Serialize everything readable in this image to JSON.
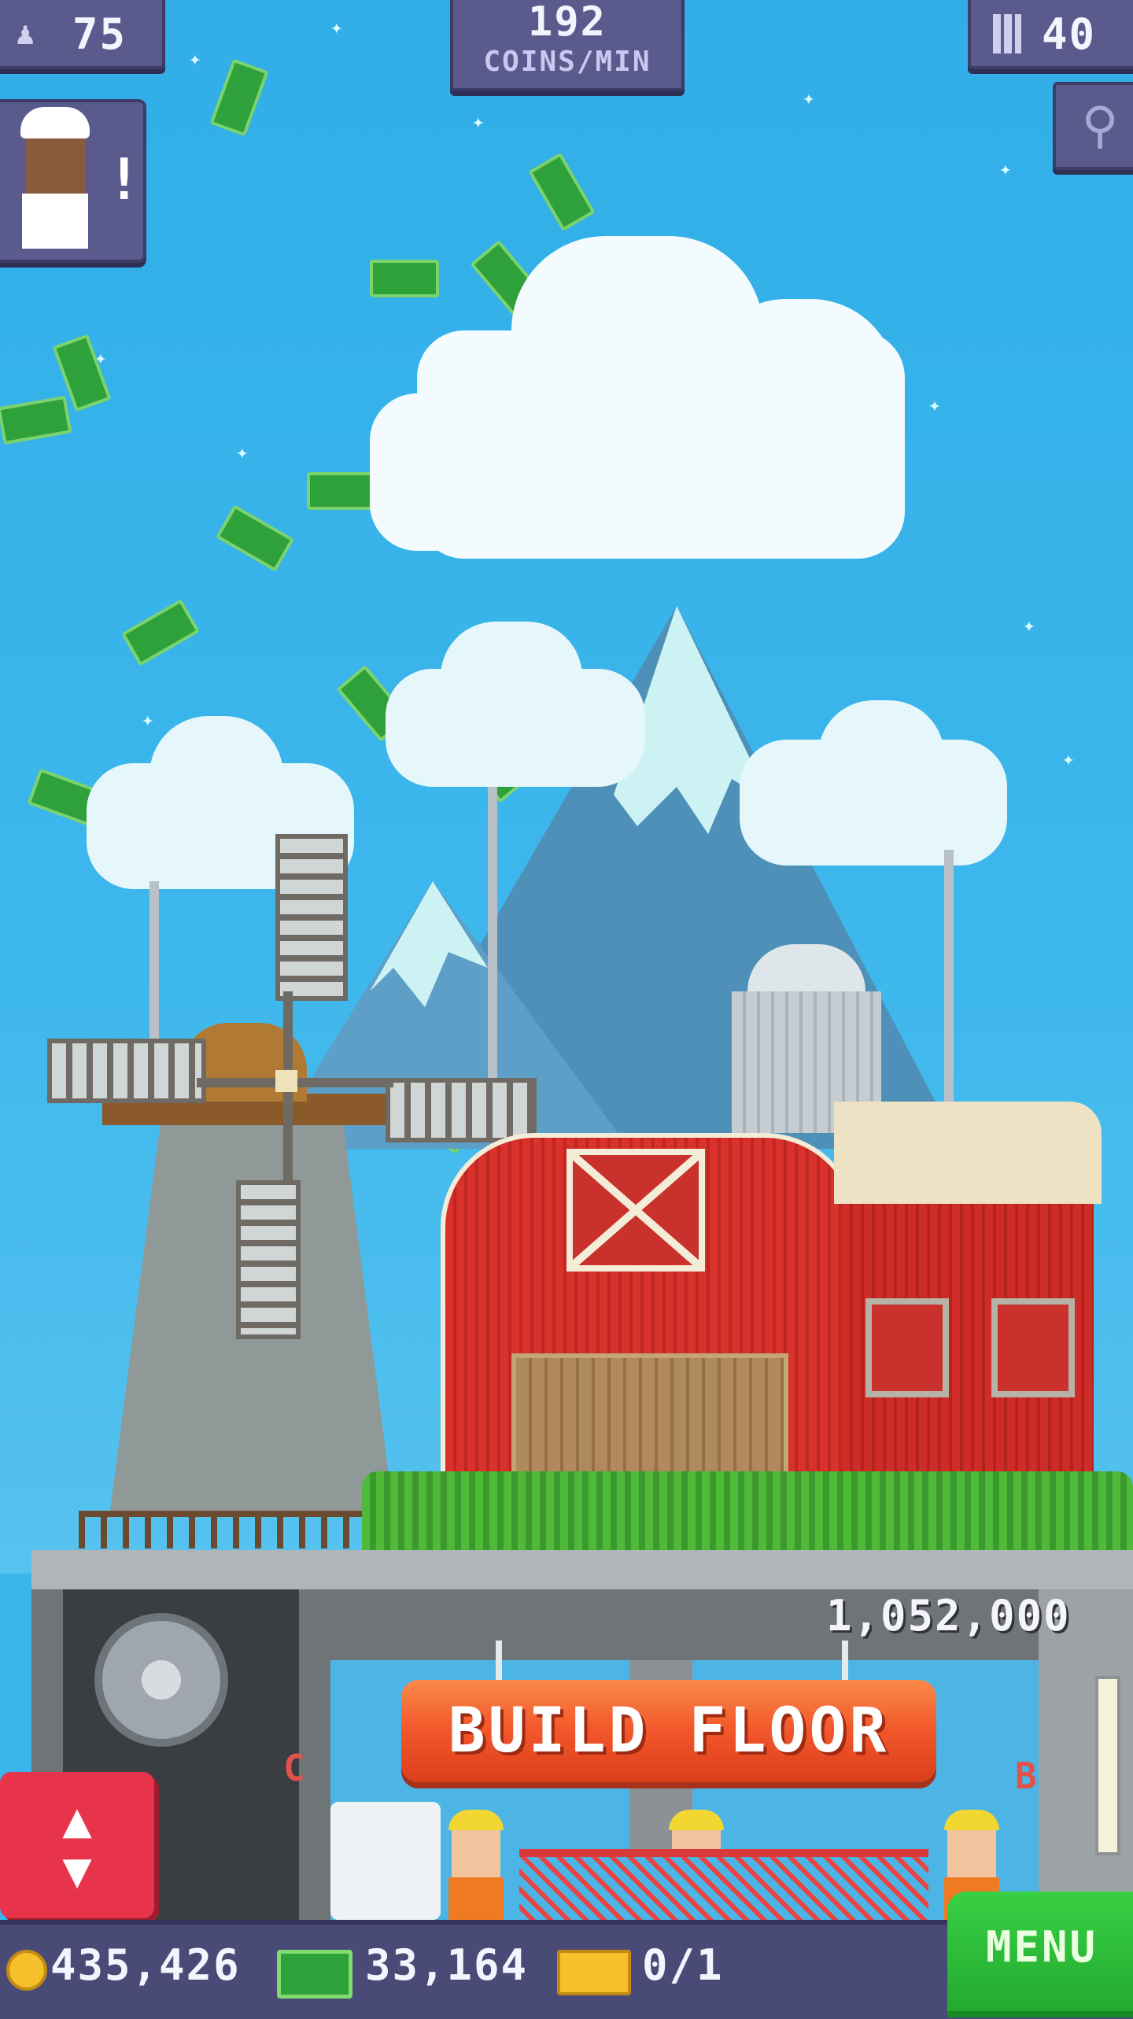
{
  "hud": {
    "population": "75",
    "coins_rate_value": "192",
    "coins_rate_label": "COINS/MIN",
    "floors": "40"
  },
  "build": {
    "label": "BUILD FLOOR",
    "cost": "1,052,000"
  },
  "shop_letters": {
    "left": "C",
    "right": "B"
  },
  "bottom_bar": {
    "coins": "435,426",
    "bux": "33,164",
    "tickets": "0/1",
    "menu_label": "MENU"
  },
  "colors": {
    "sky": "#3ab4ea",
    "hud_panel": "#5a5a8c",
    "build_button": "#f2562a",
    "menu_button": "#2fbd3a",
    "elevator_button": "#e8344a",
    "barn_red": "#d9322c"
  },
  "icons": {
    "population": "person-icon",
    "floors": "building-icon",
    "zoom": "magnifier-icon",
    "elevator": "up-down-arrows-icon",
    "coin": "coin-icon",
    "bux": "banknote-icon",
    "ticket": "ticket-icon"
  }
}
